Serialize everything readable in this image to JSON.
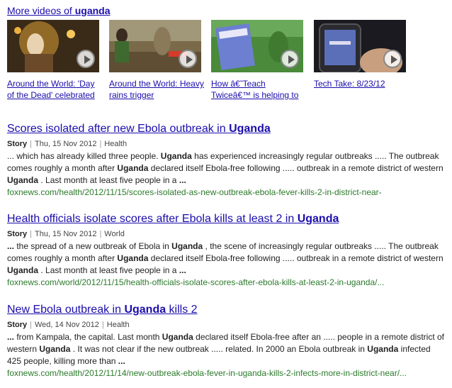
{
  "more_videos": {
    "prefix": "More videos of ",
    "term": "uganda"
  },
  "videos": [
    {
      "caption": "Around the World: 'Day of the Dead' celebrated"
    },
    {
      "caption": "Around the World: Heavy rains trigger"
    },
    {
      "caption": "How â€˜Teach Twiceâ€™ is helping to"
    },
    {
      "caption": "Tech Take: 8/23/12"
    }
  ],
  "results": [
    {
      "title_pre": "Scores isolated after new Ebola outbreak in ",
      "title_bold": "Uganda",
      "title_post": "",
      "type": "Story",
      "date": "Thu, 15 Nov 2012",
      "section": "Health",
      "snippet": [
        {
          "t": "... which has already killed three people. ",
          "b": false
        },
        {
          "t": "Uganda",
          "b": true
        },
        {
          "t": " has experienced increasingly regular outbreaks ..... The outbreak comes roughly a month after ",
          "b": false
        },
        {
          "t": "Uganda",
          "b": true
        },
        {
          "t": " declared itself Ebola-free following ..... outbreak in a remote district of western ",
          "b": false
        },
        {
          "t": "Uganda",
          "b": true
        },
        {
          "t": " . Last month at least five people in a ",
          "b": false
        },
        {
          "t": "...",
          "b": true
        }
      ],
      "url": "foxnews.com/health/2012/11/15/scores-isolated-as-new-outbreak-ebola-fever-kills-2-in-district-near-"
    },
    {
      "title_pre": "Health officials isolate scores after Ebola kills at least 2 in ",
      "title_bold": "Uganda",
      "title_post": "",
      "type": "Story",
      "date": "Thu, 15 Nov 2012",
      "section": "World",
      "snippet": [
        {
          "t": "...",
          "b": true
        },
        {
          "t": " the spread of a new outbreak of Ebola in ",
          "b": false
        },
        {
          "t": "Uganda",
          "b": true
        },
        {
          "t": " , the scene of increasingly regular outbreaks ..... The outbreak comes roughly a month after ",
          "b": false
        },
        {
          "t": "Uganda",
          "b": true
        },
        {
          "t": " declared itself Ebola-free following ..... outbreak in a remote district of western ",
          "b": false
        },
        {
          "t": "Uganda",
          "b": true
        },
        {
          "t": " . Last month at least five people in a ",
          "b": false
        },
        {
          "t": "...",
          "b": true
        }
      ],
      "url": "foxnews.com/world/2012/11/15/health-officials-isolate-scores-after-ebola-kills-at-least-2-in-uganda/..."
    },
    {
      "title_pre": "New Ebola outbreak in ",
      "title_bold": "Uganda",
      "title_post": " kills 2",
      "type": "Story",
      "date": "Wed, 14 Nov 2012",
      "section": "Health",
      "snippet": [
        {
          "t": "...",
          "b": true
        },
        {
          "t": " from Kampala, the capital. Last month ",
          "b": false
        },
        {
          "t": "Uganda",
          "b": true
        },
        {
          "t": " declared itself Ebola-free after an ..... people in a remote district of western ",
          "b": false
        },
        {
          "t": "Uganda",
          "b": true
        },
        {
          "t": " . It was not clear if the new outbreak ..... related. In 2000 an Ebola outbreak in ",
          "b": false
        },
        {
          "t": "Uganda",
          "b": true
        },
        {
          "t": " infected 425 people, killing more than ",
          "b": false
        },
        {
          "t": "...",
          "b": true
        }
      ],
      "url": "foxnews.com/health/2012/11/14/new-outbreak-ebola-fever-in-uganda-kills-2-infects-more-in-district-near/..."
    }
  ]
}
